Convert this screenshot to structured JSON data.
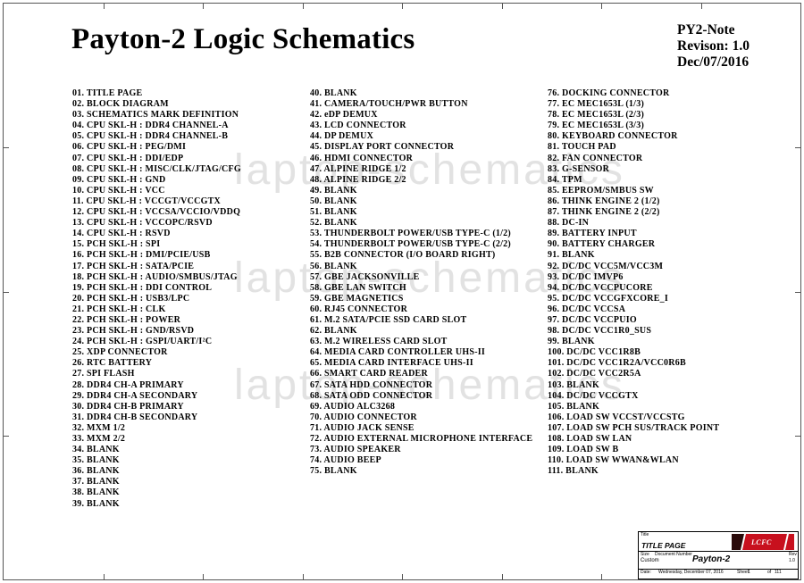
{
  "header": {
    "title": "Payton-2 Logic Schematics",
    "project": "PY2-Note",
    "revision": "Revison: 1.0",
    "date": "Dec/07/2016"
  },
  "watermark": "laptop-schematics",
  "toc": {
    "col1": [
      "01. TITLE PAGE",
      "02. BLOCK DIAGRAM",
      "03. SCHEMATICS MARK DEFINITION",
      "04. CPU SKL-H : DDR4 CHANNEL-A",
      "05. CPU SKL-H : DDR4 CHANNEL-B",
      "06. CPU SKL-H : PEG/DMI",
      "07. CPU SKL-H : DDI/EDP",
      "08. CPU SKL-H : MISC/CLK/JTAG/CFG",
      "09. CPU SKL-H : GND",
      "10. CPU SKL-H : VCC",
      "11. CPU SKL-H : VCCGT/VCCGTX",
      "12. CPU SKL-H : VCCSA/VCCIO/VDDQ",
      "13. CPU SKL-H : VCCOPC/RSVD",
      "14. CPU SKL-H : RSVD",
      "15. PCH SKL-H : SPI",
      "16. PCH SKL-H : DMI/PCIE/USB",
      "17. PCH SKL-H : SATA/PCIE",
      "18. PCH SKL-H : AUDIO/SMBUS/JTAG",
      "19. PCH SKL-H : DDI CONTROL",
      "20. PCH SKL-H : USB3/LPC",
      "21. PCH SKL-H : CLK",
      "22. PCH SKL-H : POWER",
      "23. PCH SKL-H : GND/RSVD",
      "24. PCH SKL-H : GSPI/UART/I²C",
      "25. XDP CONNECTOR",
      "26. RTC BATTERY",
      "27. SPI FLASH",
      "28. DDR4 CH-A PRIMARY",
      "29. DDR4 CH-A SECONDARY",
      "30. DDR4 CH-B PRIMARY",
      "31. DDR4 CH-B SECONDARY",
      "32. MXM 1/2",
      "33. MXM 2/2",
      "34. BLANK",
      "35. BLANK",
      "36. BLANK",
      "37. BLANK",
      "38. BLANK",
      "39. BLANK"
    ],
    "col2": [
      "40. BLANK",
      "41. CAMERA/TOUCH/PWR BUTTON",
      "42. eDP DEMUX",
      "43. LCD CONNECTOR",
      "44. DP DEMUX",
      "45. DISPLAY PORT CONNECTOR",
      "46. HDMI CONNECTOR",
      "47. ALPINE RIDGE 1/2",
      "48. ALPINE RIDGE 2/2",
      "49. BLANK",
      "50. BLANK",
      "51. BLANK",
      "52. BLANK",
      "53. THUNDERBOLT POWER/USB TYPE-C (1/2)",
      "54. THUNDERBOLT POWER/USB TYPE-C (2/2)",
      "55. B2B CONNECTOR (I/O BOARD RIGHT)",
      "56. BLANK",
      "57. GBE JACKSONVILLE",
      "58. GBE LAN SWITCH",
      "59. GBE MAGNETICS",
      "60. RJ45 CONNECTOR",
      "61. M.2 SATA/PCIE SSD CARD SLOT",
      "62. BLANK",
      "63. M.2 WIRELESS CARD SLOT",
      "64. MEDIA CARD CONTROLLER UHS-II",
      "65. MEDIA CARD INTERFACE UHS-II",
      "66. SMART CARD READER",
      "67. SATA HDD CONNECTOR",
      "68. SATA ODD CONNECTOR",
      "69. AUDIO ALC3268",
      "70. AUDIO CONNECTOR",
      "71. AUDIO JACK SENSE",
      "72. AUDIO EXTERNAL MICROPHONE INTERFACE",
      "73. AUDIO SPEAKER",
      "74. AUDIO BEEP",
      "75. BLANK"
    ],
    "col3": [
      "76. DOCKING CONNECTOR",
      "77. EC MEC1653L (1/3)",
      "78. EC MEC1653L (2/3)",
      "79. EC MEC1653L (3/3)",
      "80. KEYBOARD CONNECTOR",
      "81. TOUCH PAD",
      "82. FAN CONNECTOR",
      "83. G-SENSOR",
      "84. TPM",
      "85. EEPROM/SMBUS SW",
      "86. THINK ENGINE 2 (1/2)",
      "87. THINK ENGINE 2 (2/2)",
      "88. DC-IN",
      "89. BATTERY INPUT",
      "90. BATTERY  CHARGER",
      "91. BLANK",
      "92. DC/DC VCC5M/VCC3M",
      "93. DC/DC IMVP6",
      "94. DC/DC VCCPUCORE",
      "95. DC/DC VCCGFXCORE_I",
      "96. DC/DC VCCSA",
      "97. DC/DC VCCPUIO",
      "98. DC/DC VCC1R0_SUS",
      "99. BLANK",
      "100. DC/DC VCC1R8B",
      "101. DC/DC VCC1R2A/VCC0R6B",
      "102. DC/DC VCC2R5A",
      "103. BLANK",
      "104. DC/DC VCCGTX",
      "105. BLANK",
      "106. LOAD SW VCCST/VCCSTG",
      "107. LOAD SW PCH SUS/TRACK POINT",
      "108. LOAD SW LAN",
      "109. LOAD SW B",
      "110. LOAD SW WWAN&WLAN",
      "111. BLANK"
    ]
  },
  "title_block": {
    "title_label": "Title",
    "page_title": "TITLE PAGE",
    "size_label": "Size",
    "size_value": "Custom",
    "docnum_label": "Document Number",
    "docnum_value": "Payton-2",
    "rev_label": "Rev",
    "rev_value": "1.0",
    "date_label": "Date:",
    "date_value": "Wednesday, December 07, 2016",
    "sheet_label": "Sheet",
    "sheet_value": "1",
    "of_label": "of",
    "of_value": "111",
    "logo_text": "LCFC",
    "colors": {
      "logo_red": "#c8101e",
      "logo_dark": "#2a0a0a"
    }
  }
}
